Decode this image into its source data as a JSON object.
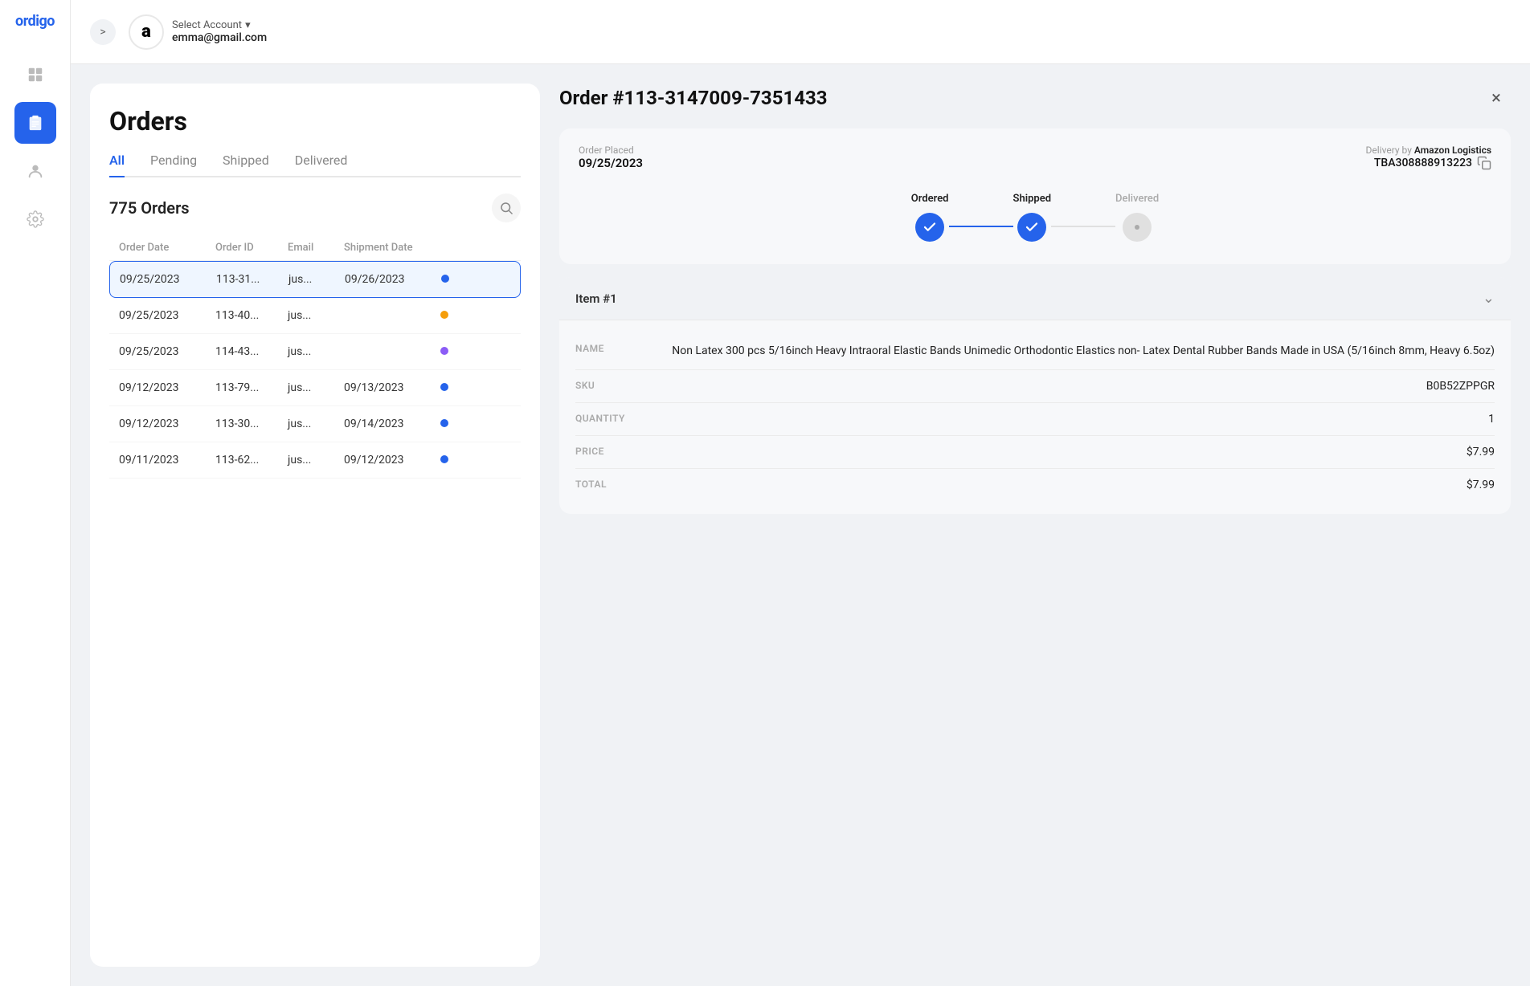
{
  "sidebar": {
    "logo": "ordigo",
    "items": [
      {
        "id": "dashboard",
        "icon": "grid"
      },
      {
        "id": "orders",
        "icon": "clipboard",
        "active": true
      },
      {
        "id": "profile",
        "icon": "user"
      },
      {
        "id": "settings",
        "icon": "gear"
      }
    ]
  },
  "header": {
    "collapse_label": ">",
    "select_account_label": "Select Account",
    "email": "emma@gmail.com"
  },
  "orders_panel": {
    "title": "Orders",
    "tabs": [
      {
        "id": "all",
        "label": "All",
        "active": true
      },
      {
        "id": "pending",
        "label": "Pending"
      },
      {
        "id": "shipped",
        "label": "Shipped"
      },
      {
        "id": "delivered",
        "label": "Delivered"
      }
    ],
    "orders_count": "775 Orders",
    "table_headers": [
      "Order Date",
      "Order ID",
      "Email",
      "Shipment Date",
      ""
    ],
    "rows": [
      {
        "order_date": "09/25/2023",
        "order_id": "113-31...",
        "email": "jus...",
        "shipment_date": "09/26/2023",
        "status": "blue",
        "selected": true
      },
      {
        "order_date": "09/25/2023",
        "order_id": "113-40...",
        "email": "jus...",
        "shipment_date": "",
        "status": "yellow",
        "selected": false
      },
      {
        "order_date": "09/25/2023",
        "order_id": "114-43...",
        "email": "jus...",
        "shipment_date": "",
        "status": "purple",
        "selected": false
      },
      {
        "order_date": "09/12/2023",
        "order_id": "113-79...",
        "email": "jus...",
        "shipment_date": "09/13/2023",
        "status": "blue",
        "selected": false
      },
      {
        "order_date": "09/12/2023",
        "order_id": "113-30...",
        "email": "jus...",
        "shipment_date": "09/14/2023",
        "status": "blue",
        "selected": false
      },
      {
        "order_date": "09/11/2023",
        "order_id": "113-62...",
        "email": "jus...",
        "shipment_date": "09/12/2023",
        "status": "blue",
        "selected": false
      }
    ]
  },
  "order_detail": {
    "order_number": "Order #113-3147009-7351433",
    "close_label": "×",
    "order_placed_label": "Order Placed",
    "order_placed_date": "09/25/2023",
    "delivery_by_label": "Delivery by",
    "delivery_carrier": "Amazon Logistics",
    "tracking_number": "TBA308888913223",
    "progress": {
      "steps": [
        {
          "label": "Ordered",
          "done": true
        },
        {
          "label": "Shipped",
          "done": true
        },
        {
          "label": "Delivered",
          "done": false
        }
      ]
    },
    "item": {
      "item_number": "Item #1",
      "name_label": "NAME",
      "name_value": "Non Latex 300 pcs 5/16inch Heavy Intraoral Elastic Bands Unimedic Orthodontic Elastics non- Latex Dental Rubber Bands Made in USA (5/16inch 8mm, Heavy 6.5oz)",
      "sku_label": "SKU",
      "sku_value": "B0B52ZPPGR",
      "quantity_label": "QUANTITY",
      "quantity_value": "1",
      "price_label": "PRICE",
      "price_value": "$7.99",
      "total_label": "TOTAL",
      "total_value": "$7.99"
    }
  }
}
